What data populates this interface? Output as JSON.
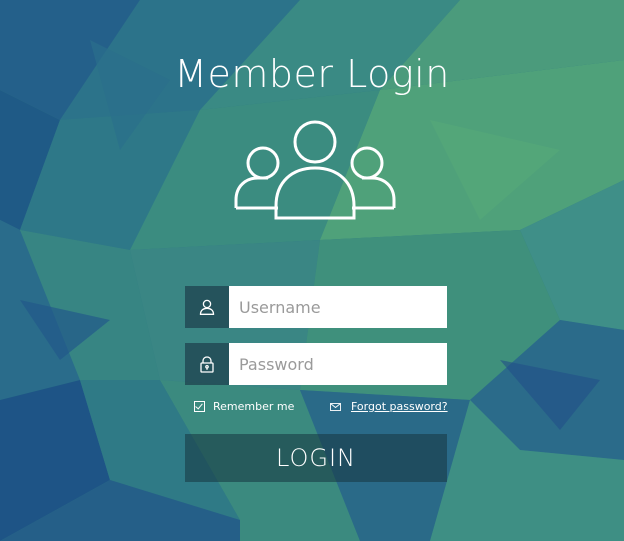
{
  "title": "Member Login",
  "form": {
    "username_placeholder": "Username",
    "password_placeholder": "Password",
    "remember_label": "Remember me",
    "forgot_label": "Forgot password?",
    "login_label": "LOGIN"
  },
  "icons": {
    "users": "users-group-icon",
    "username": "user-icon",
    "password": "lock-icon",
    "remember": "checkbox-icon",
    "forgot": "mail-icon"
  },
  "colors": {
    "background_dark": "#1f5a86",
    "background_teal": "#2f7f87",
    "background_green": "#4aa07a",
    "input_bg": "#ffffff",
    "icon_cell": "#1d3d4e",
    "text": "#ffffff"
  }
}
